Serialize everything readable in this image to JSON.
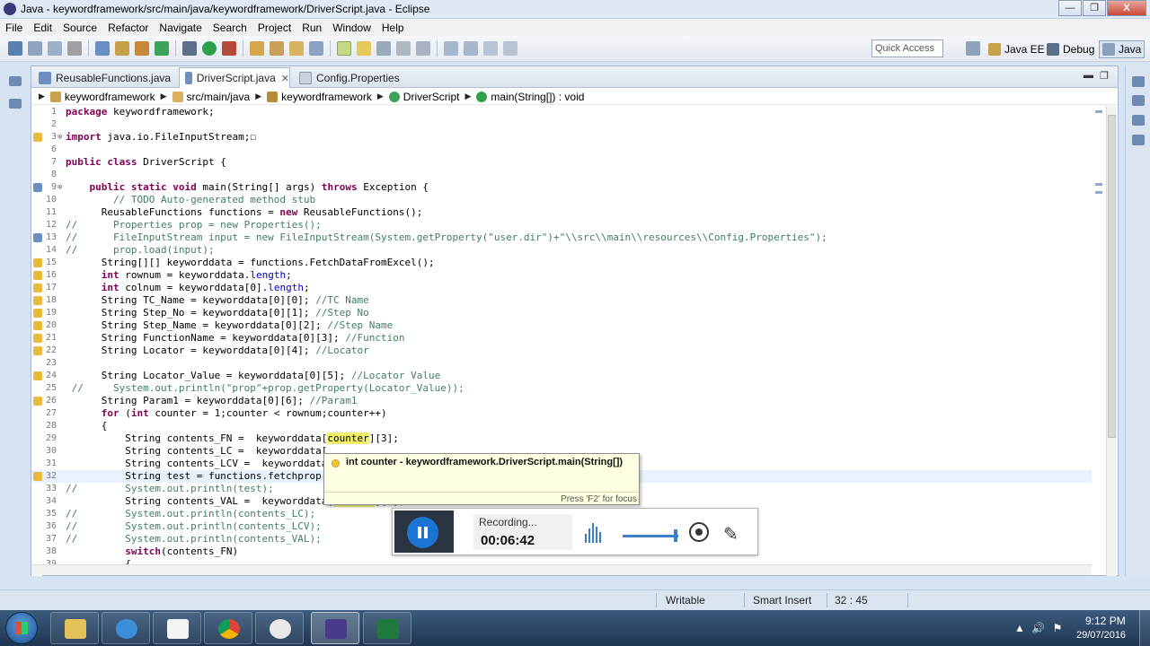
{
  "window": {
    "title": "Java - keywordframework/src/main/java/keywordframework/DriverScript.java - Eclipse",
    "controls": [
      "—",
      "❐",
      "X"
    ]
  },
  "menubar": [
    "File",
    "Edit",
    "Source",
    "Refactor",
    "Navigate",
    "Search",
    "Project",
    "Run",
    "Window",
    "Help"
  ],
  "toolbar": {
    "quick_access_placeholder": "Quick Access",
    "perspectives": [
      "Java EE",
      "Debug",
      "Java"
    ]
  },
  "tabs": [
    {
      "label": "ReusableFunctions.java",
      "active": false
    },
    {
      "label": "DriverScript.java",
      "active": true
    },
    {
      "label": "Config.Properties",
      "active": false
    }
  ],
  "tab_close_glyph": "✕",
  "breadcrumb": [
    "keywordframework",
    "src/main/java",
    "keywordframework",
    "DriverScript",
    "main(String[]) : void"
  ],
  "breadcrumb_sep": "▶",
  "code_lines": [
    {
      "n": "1",
      "text": "package keywordframework;"
    },
    {
      "n": "2",
      "text": ""
    },
    {
      "n": "3",
      "text": "import java.io.FileInputStream;☐"
    },
    {
      "n": "6",
      "text": ""
    },
    {
      "n": "7",
      "text": "public class DriverScript {"
    },
    {
      "n": "8",
      "text": ""
    },
    {
      "n": "9",
      "text": "    public static void main(String[] args) throws Exception {"
    },
    {
      "n": "10",
      "text": "        // TODO Auto-generated method stub"
    },
    {
      "n": "11",
      "text": "      ReusableFunctions functions = new ReusableFunctions();"
    },
    {
      "n": "12",
      "text": "//      Properties prop = new Properties();"
    },
    {
      "n": "13",
      "text": "//      FileInputStream input = new FileInputStream(System.getProperty(\"user.dir\")+\"\\\\src\\\\main\\\\resources\\\\Config.Properties\");"
    },
    {
      "n": "14",
      "text": "//      prop.load(input);"
    },
    {
      "n": "15",
      "text": "      String[][] keyworddata = functions.FetchDataFromExcel();"
    },
    {
      "n": "16",
      "text": "      int rownum = keyworddata.length;"
    },
    {
      "n": "17",
      "text": "      int colnum = keyworddata[0].length;"
    },
    {
      "n": "18",
      "text": "      String TC_Name = keyworddata[0][0]; //TC Name"
    },
    {
      "n": "19",
      "text": "      String Step_No = keyworddata[0][1]; //Step No"
    },
    {
      "n": "20",
      "text": "      String Step_Name = keyworddata[0][2]; //Step Name"
    },
    {
      "n": "21",
      "text": "      String FunctionName = keyworddata[0][3]; //Function"
    },
    {
      "n": "22",
      "text": "      String Locator = keyworddata[0][4]; //Locator"
    },
    {
      "n": "23",
      "text": ""
    },
    {
      "n": "24",
      "text": "      String Locator_Value = keyworddata[0][5]; //Locator Value"
    },
    {
      "n": "25",
      "text": " //     System.out.println(\"prop\"+prop.getProperty(Locator_Value));"
    },
    {
      "n": "26",
      "text": "      String Param1 = keyworddata[0][6]; //Param1"
    },
    {
      "n": "27",
      "text": "      for (int counter = 1;counter < rownum;counter++)"
    },
    {
      "n": "28",
      "text": "      {"
    },
    {
      "n": "29",
      "text": "          String contents_FN =  keyworddata[counter][3];"
    },
    {
      "n": "30",
      "text": "          String contents_LC =  keyworddata["
    },
    {
      "n": "31",
      "text": "          String contents_LCV =  keyworddata"
    },
    {
      "n": "32",
      "text": "          String test = functions.fetchprop("
    },
    {
      "n": "33",
      "text": "//        System.out.println(test);"
    },
    {
      "n": "34",
      "text": "          String contents_VAL =  keyworddata[counter][6];"
    },
    {
      "n": "35",
      "text": "//        System.out.println(contents_LC);"
    },
    {
      "n": "36",
      "text": "//        System.out.println(contents_LCV);"
    },
    {
      "n": "37",
      "text": "//        System.out.println(contents_VAL);"
    },
    {
      "n": "38",
      "text": "          switch(contents_FN)"
    },
    {
      "n": "39",
      "text": "          {"
    }
  ],
  "tooltip": {
    "text": "int counter - keywordframework.DriverScript.main(String[])",
    "footer": "Press 'F2' for focus"
  },
  "recorder": {
    "status": "Recording...",
    "time": "00:06:42",
    "pen_glyph": "✎"
  },
  "statusbar": {
    "writable": "Writable",
    "insert_mode": "Smart Insert",
    "position": "32 : 45"
  },
  "taskbar": {
    "time": "9:12 PM",
    "date": "29/07/2016",
    "tray_glyphs": [
      "▲",
      "🔊",
      "⚑"
    ]
  },
  "colors": {
    "keyword": "#7f0055",
    "comment": "#3f7f5f",
    "string": "#2a00ff",
    "field": "#0000c0",
    "current_line": "#e8f2fe",
    "highlight": "#f2f06a"
  }
}
